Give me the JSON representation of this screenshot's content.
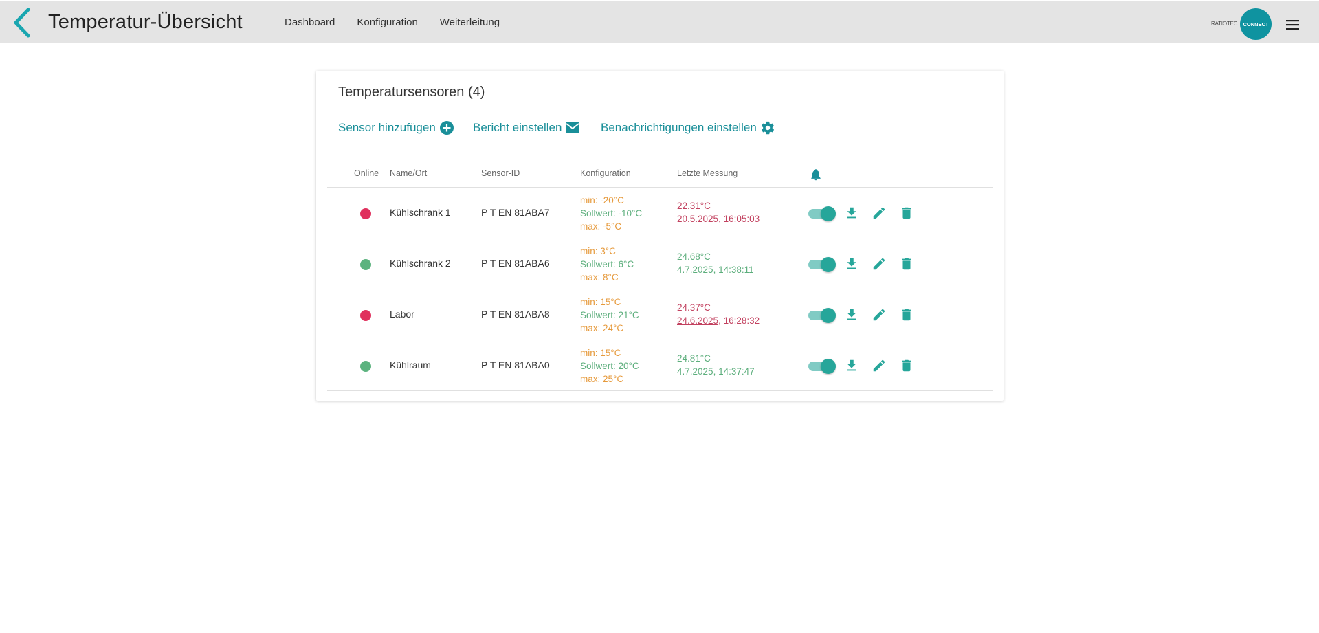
{
  "header": {
    "title": "Temperatur-Übersicht",
    "nav": [
      "Dashboard",
      "Konfiguration",
      "Weiterleitung"
    ],
    "logo_small": "RATIOTEC",
    "logo_circle": "CONNECT"
  },
  "card": {
    "title": "Temperatursensoren (4)",
    "actions": {
      "add_sensor": "Sensor hinzufügen",
      "report": "Bericht einstellen",
      "notifications": "Benachrichtigungen einstellen"
    },
    "columns": {
      "online": "Online",
      "name": "Name/Ort",
      "sensor_id": "Sensor-ID",
      "config": "Konfiguration",
      "last": "Letzte Messung"
    },
    "rows": [
      {
        "online": false,
        "name": "Kühlschrank 1",
        "sensor_id": "P T EN 81ABA7",
        "min": "min: -20°C",
        "sollwert": "Sollwert: -10°C",
        "max": "max: -5°C",
        "temp": "22.31°C",
        "date": "20.5.2025",
        "time": ", 16:05:03",
        "alarm": true,
        "enabled": true
      },
      {
        "online": true,
        "name": "Kühlschrank 2",
        "sensor_id": "P T EN 81ABA6",
        "min": "min: 3°C",
        "sollwert": "Sollwert: 6°C",
        "max": "max: 8°C",
        "temp": "24.68°C",
        "date": "4.7.2025",
        "time": ", 14:38:11",
        "alarm": false,
        "enabled": true
      },
      {
        "online": false,
        "name": "Labor",
        "sensor_id": "P T EN 81ABA8",
        "min": "min: 15°C",
        "sollwert": "Sollwert: 21°C",
        "max": "max: 24°C",
        "temp": "24.37°C",
        "date": "24.6.2025",
        "time": ", 16:28:32",
        "alarm": true,
        "enabled": true
      },
      {
        "online": true,
        "name": "Kühlraum",
        "sensor_id": "P T EN 81ABA0",
        "min": "min: 15°C",
        "sollwert": "Sollwert: 20°C",
        "max": "max: 25°C",
        "temp": "24.81°C",
        "date": "4.7.2025",
        "time": ", 14:37:47",
        "alarm": false,
        "enabled": true
      }
    ]
  },
  "colors": {
    "accent": "#1a8f99",
    "offline": "#e0305d",
    "online": "#5cb37f",
    "icon": "#26a69a"
  },
  "icons": [
    "back-chevron-icon",
    "menu-icon",
    "add-circle-icon",
    "mail-icon",
    "gear-icon",
    "bell-icon",
    "download-icon",
    "edit-icon",
    "delete-icon"
  ]
}
